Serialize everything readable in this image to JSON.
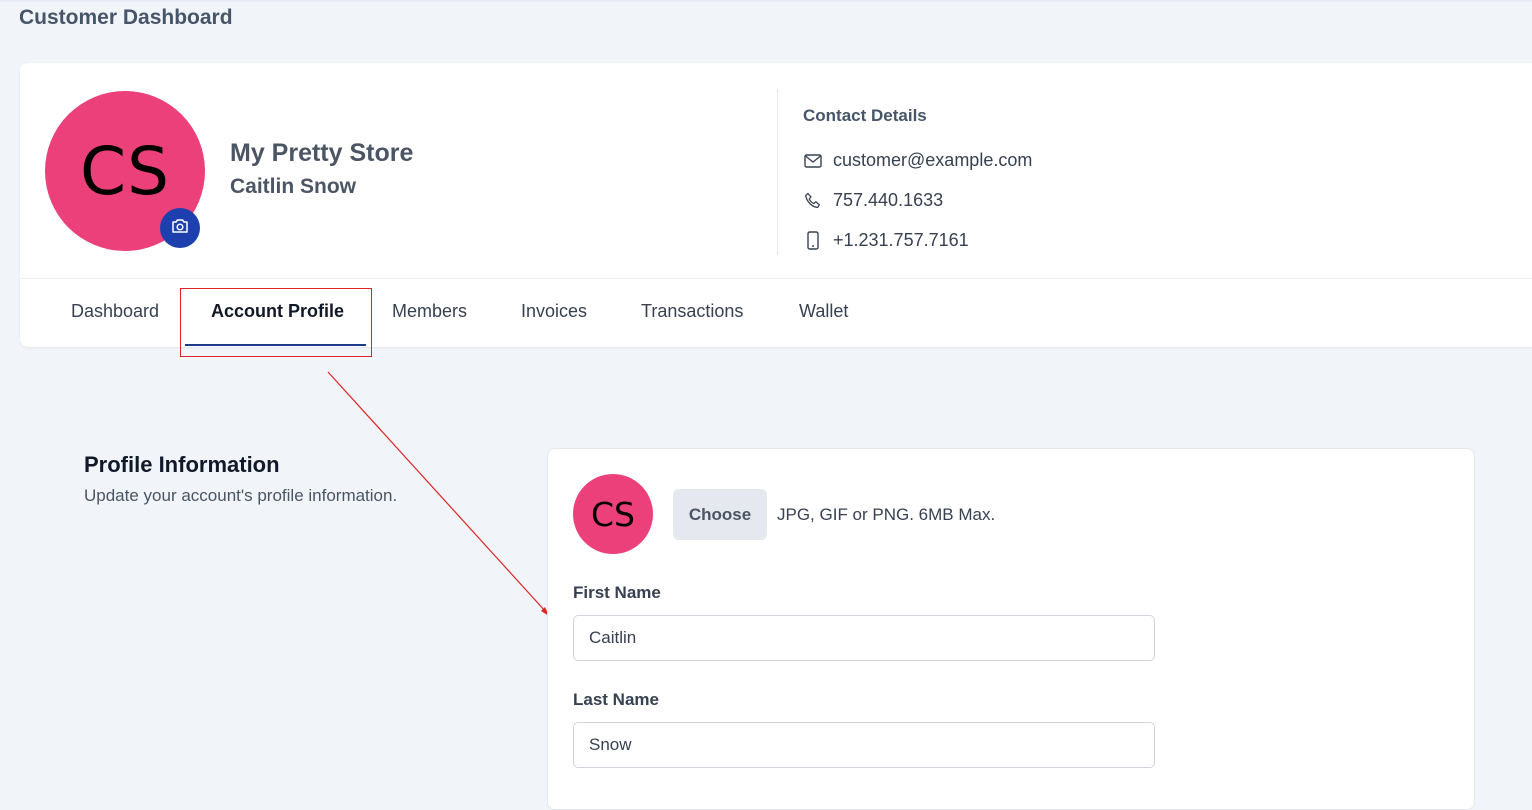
{
  "page": {
    "title": "Customer Dashboard"
  },
  "profile": {
    "avatar_initials": "CS",
    "store_name": "My Pretty Store",
    "owner_name": "Caitlin Snow",
    "avatar_color": "#ec407a"
  },
  "contact": {
    "title": "Contact Details",
    "email": "customer@example.com",
    "phone": "757.440.1633",
    "mobile": "+1.231.757.7161"
  },
  "tabs": [
    {
      "label": "Dashboard",
      "active": false
    },
    {
      "label": "Account Profile",
      "active": true
    },
    {
      "label": "Members",
      "active": false
    },
    {
      "label": "Invoices",
      "active": false
    },
    {
      "label": "Transactions",
      "active": false
    },
    {
      "label": "Wallet",
      "active": false
    }
  ],
  "profile_section": {
    "title": "Profile Information",
    "subtitle": "Update your account's profile information."
  },
  "form": {
    "avatar_initials": "CS",
    "choose_label": "Choose",
    "choose_hint": "JPG, GIF or PNG. 6MB Max.",
    "first_name_label": "First Name",
    "first_name_value": "Caitlin",
    "last_name_label": "Last Name",
    "last_name_value": "Snow"
  },
  "colors": {
    "accent": "#1e40af",
    "annotation": "#e02424"
  },
  "icons": {
    "camera": "camera-icon",
    "email": "mail-icon",
    "phone": "phone-icon",
    "mobile": "mobile-icon"
  }
}
